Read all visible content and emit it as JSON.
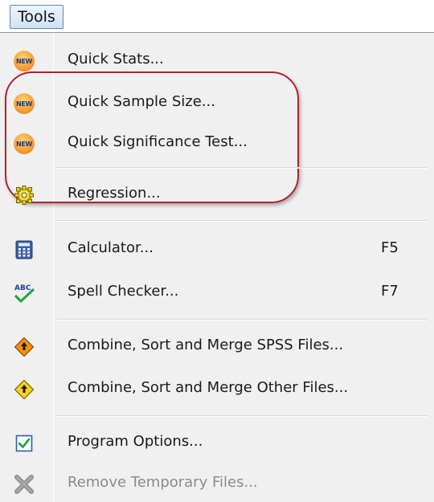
{
  "menu": {
    "title": "Tools",
    "items": [
      {
        "label": "Quick Stats...",
        "icon": "new-badge-icon",
        "badge": "NEW"
      },
      {
        "label": "Quick Sample Size...",
        "icon": "new-badge-icon",
        "badge": "NEW"
      },
      {
        "label": "Quick Significance Test...",
        "icon": "new-badge-icon",
        "badge": "NEW"
      },
      {
        "label": "Regression...",
        "icon": "gear-icon"
      },
      {
        "label": "Calculator...",
        "icon": "calculator-icon",
        "shortcut": "F5"
      },
      {
        "label": "Spell Checker...",
        "icon": "spell-check-icon",
        "shortcut": "F7",
        "icon_text": "ABC"
      },
      {
        "label": "Combine, Sort and Merge SPSS Files...",
        "icon": "merge-orange-icon"
      },
      {
        "label": "Combine, Sort and Merge Other Files...",
        "icon": "merge-yellow-icon"
      },
      {
        "label": "Program Options...",
        "icon": "checkbox-checked-icon"
      },
      {
        "label": "Remove Temporary Files...",
        "icon": "remove-x-icon",
        "disabled": true
      }
    ]
  },
  "colors": {
    "highlight_border": "#b4222c",
    "menu_background": "#f0f0f0",
    "disabled_text": "#8a8a8a",
    "title_border": "#5b86b5"
  }
}
